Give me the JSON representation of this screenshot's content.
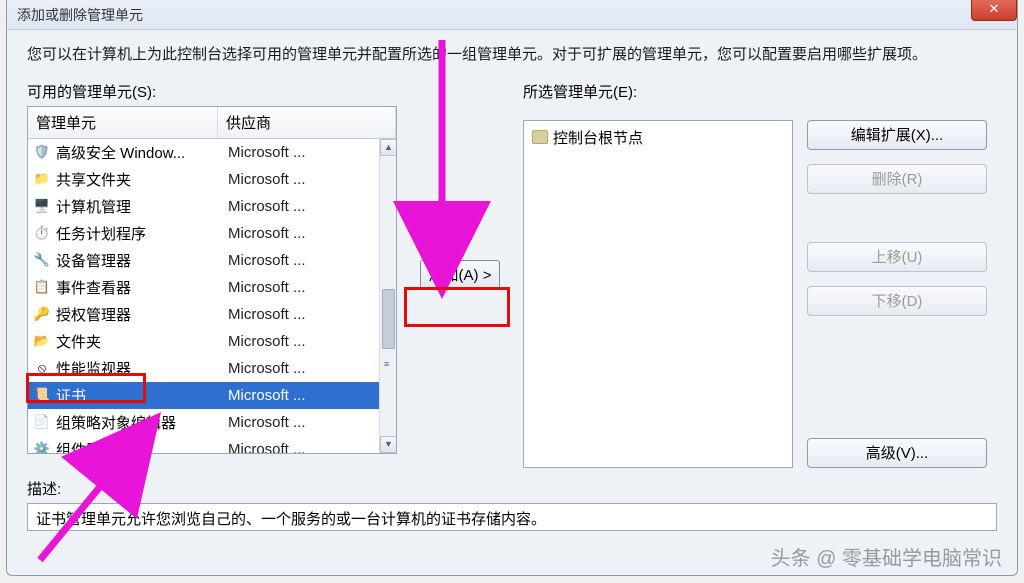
{
  "window": {
    "title": "添加或删除管理单元",
    "close_glyph": "✕"
  },
  "instruction": "您可以在计算机上为此控制台选择可用的管理单元并配置所选的一组管理单元。对于可扩展的管理单元，您可以配置要启用哪些扩展项。",
  "left": {
    "label": "可用的管理单元(S):",
    "header_name": "管理单元",
    "header_vendor": "供应商",
    "items": [
      {
        "icon": "🛡️",
        "name": "高级安全 Window...",
        "vendor": "Microsoft ..."
      },
      {
        "icon": "📁",
        "name": "共享文件夹",
        "vendor": "Microsoft ..."
      },
      {
        "icon": "🖥️",
        "name": "计算机管理",
        "vendor": "Microsoft ..."
      },
      {
        "icon": "⏱️",
        "name": "任务计划程序",
        "vendor": "Microsoft ..."
      },
      {
        "icon": "🔧",
        "name": "设备管理器",
        "vendor": "Microsoft ..."
      },
      {
        "icon": "📋",
        "name": "事件查看器",
        "vendor": "Microsoft ..."
      },
      {
        "icon": "🔑",
        "name": "授权管理器",
        "vendor": "Microsoft ..."
      },
      {
        "icon": "📂",
        "name": "文件夹",
        "vendor": "Microsoft ..."
      },
      {
        "icon": "⦸",
        "name": "性能监视器",
        "vendor": "Microsoft ..."
      },
      {
        "icon": "📜",
        "name": "证书",
        "vendor": "Microsoft ...",
        "selected": true
      },
      {
        "icon": "📄",
        "name": "组策略对象编辑器",
        "vendor": "Microsoft ..."
      },
      {
        "icon": "⚙️",
        "name": "组件服",
        "vendor": "Microsoft ..."
      }
    ]
  },
  "mid": {
    "add_label": "添加(A) >"
  },
  "right": {
    "label": "所选管理单元(E):",
    "tree_root": "控制台根节点",
    "btn_edit_ext": "编辑扩展(X)...",
    "btn_remove": "删除(R)",
    "btn_up": "上移(U)",
    "btn_down": "下移(D)",
    "btn_adv": "高级(V)..."
  },
  "descr": {
    "label": "描述:",
    "text": "证书管理单元允许您浏览自己的、一个服务的或一台计算机的证书存储内容。"
  },
  "watermark": "头条 @ 零基础学电脑常识"
}
